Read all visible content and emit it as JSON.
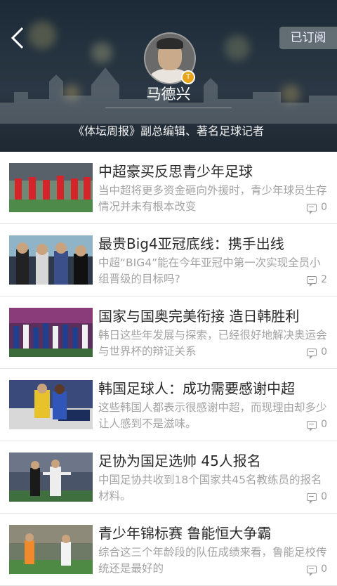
{
  "header": {
    "subscribe_label": "已订阅",
    "name": "马德兴",
    "bio": "《体坛周报》副总编辑、著名足球记者",
    "badge": "T"
  },
  "articles": [
    {
      "title": "中超豪买反思青少年足球",
      "summary": "当中超将更多资金砸向外援时，青少年球员生存情况并未有根本改变",
      "comments": "0"
    },
    {
      "title": "最贵Big4亚冠底线：携手出线",
      "summary": "中超“BIG4”能在今年亚冠中第一次实现全员小组晋级的目标吗?",
      "comments": "2"
    },
    {
      "title": "国家与国奥完美衔接 造日韩胜利",
      "summary": "韩日这些年发展与探索，已经很好地解决奥运会与世界杯的辩证关系",
      "comments": "0"
    },
    {
      "title": "韩国足球人：成功需要感谢中超",
      "summary": "这些韩国人都表示很感谢中超，而现理由却多少让人感到不是滋味。",
      "comments": "0"
    },
    {
      "title": "足协为国足选帅 45人报名",
      "summary": "中国足协共收到18个国家共45名教练员的报名材料。",
      "comments": "0"
    },
    {
      "title": "青少年锦标赛 鲁能恒大争霸",
      "summary": "综合这三个年龄段的队伍成绩来看，鲁能足校传统还是最好的",
      "comments": "0"
    }
  ]
}
